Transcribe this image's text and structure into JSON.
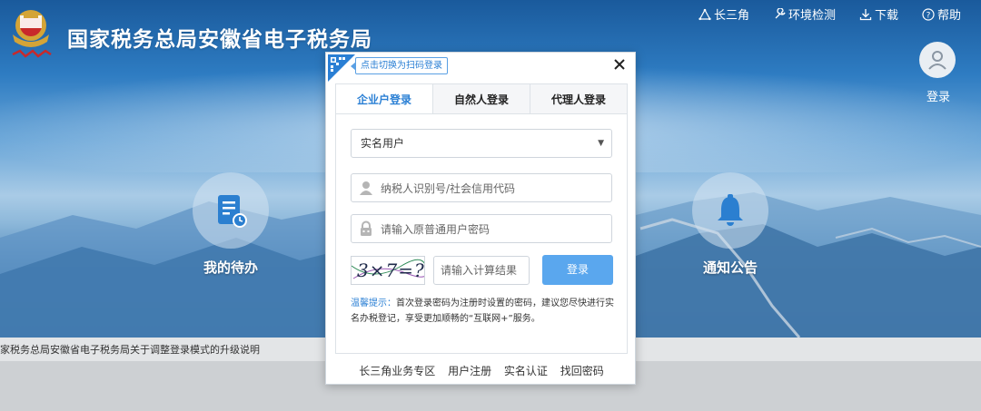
{
  "header": {
    "title": "国家税务总局安徽省电子税务局",
    "nav": [
      {
        "label": "长三角",
        "icon": "triangle-icon"
      },
      {
        "label": "环境检测",
        "icon": "wrench-icon"
      },
      {
        "label": "下载",
        "icon": "download-icon"
      },
      {
        "label": "帮助",
        "icon": "help-icon"
      }
    ],
    "login_label": "登录"
  },
  "features": {
    "todo_label": "我的待办",
    "notice_label": "通知公告"
  },
  "notice_bar": {
    "text": "家税务总局安徽省电子税务局关于调整登录模式的升级说明"
  },
  "modal": {
    "qr_tip": "点击切换为扫码登录",
    "tabs": [
      {
        "label": "企业户登录",
        "active": true
      },
      {
        "label": "自然人登录",
        "active": false
      },
      {
        "label": "代理人登录",
        "active": false
      }
    ],
    "user_type_selected": "实名用户",
    "taxpayer_placeholder": "纳税人识别号/社会信用代码",
    "password_placeholder": "请输入原普通用户密码",
    "captcha_text": "3×7=?",
    "calc_placeholder": "请输入计算结果",
    "login_button": "登录",
    "tip_label": "温馨提示：",
    "tip_text": "首次登录密码为注册时设置的密码，建议您尽快进行实名办税登记，享受更加顺畅的“互联网+”服务。",
    "footer_links": [
      "长三角业务专区",
      "用户注册",
      "实名认证",
      "找回密码"
    ]
  },
  "colors": {
    "accent": "#2a7fd4",
    "login_button": "#5aa7ee",
    "header_bg": "#2e7cc2"
  }
}
